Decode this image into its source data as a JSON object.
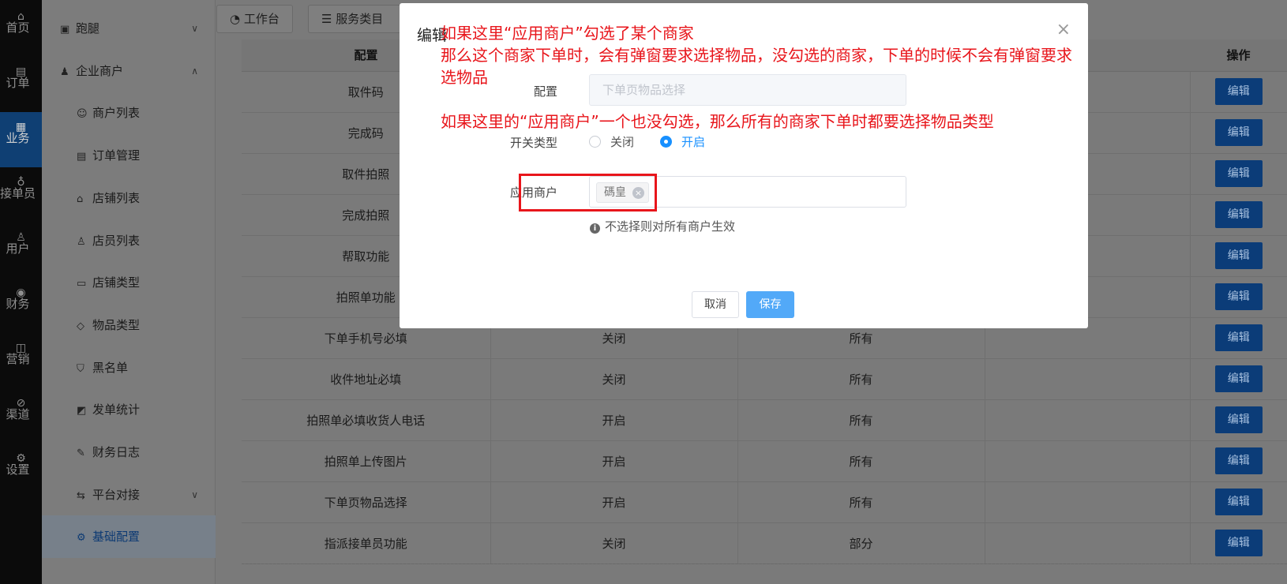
{
  "rail": [
    {
      "label": "首页",
      "icon": "home-icon",
      "glyph": "⌂"
    },
    {
      "label": "订单",
      "icon": "order-icon",
      "glyph": "▤"
    },
    {
      "label": "业务",
      "icon": "business-icon",
      "glyph": "▦",
      "active": true
    },
    {
      "label": "接单员",
      "icon": "bike-icon",
      "glyph": "♁"
    },
    {
      "label": "用户",
      "icon": "user-icon",
      "glyph": "♙"
    },
    {
      "label": "财务",
      "icon": "finance-icon",
      "glyph": "◉"
    },
    {
      "label": "营销",
      "icon": "chart-icon",
      "glyph": "◫"
    },
    {
      "label": "渠道",
      "icon": "channel-icon",
      "glyph": "⊘"
    },
    {
      "label": "设置",
      "icon": "settings-icon",
      "glyph": "⚙"
    }
  ],
  "sidebar": {
    "items": [
      {
        "label": "跑腿",
        "icon": "errand-icon",
        "glyph": "▣",
        "chevron": "∨",
        "type": "parent"
      },
      {
        "label": "企业商户",
        "icon": "merchant-group-icon",
        "glyph": "♟",
        "chevron": "∧",
        "type": "parent"
      },
      {
        "label": "商户列表",
        "icon": "merchant-list-icon",
        "glyph": "☺",
        "type": "child"
      },
      {
        "label": "订单管理",
        "icon": "order-manage-icon",
        "glyph": "▤",
        "type": "child"
      },
      {
        "label": "店铺列表",
        "icon": "shop-icon",
        "glyph": "⌂",
        "type": "child"
      },
      {
        "label": "店员列表",
        "icon": "clerk-icon",
        "glyph": "♙",
        "type": "child"
      },
      {
        "label": "店铺类型",
        "icon": "shop-type-icon",
        "glyph": "▭",
        "type": "child"
      },
      {
        "label": "物品类型",
        "icon": "tag-icon",
        "glyph": "◇",
        "type": "child"
      },
      {
        "label": "黑名单",
        "icon": "shield-icon",
        "glyph": "⛉",
        "type": "child"
      },
      {
        "label": "发单统计",
        "icon": "stats-icon",
        "glyph": "◩",
        "type": "child"
      },
      {
        "label": "财务日志",
        "icon": "log-icon",
        "glyph": "✎",
        "type": "child"
      },
      {
        "label": "平台对接",
        "icon": "swap-icon",
        "glyph": "⇆",
        "chevron": "∨",
        "type": "child"
      },
      {
        "label": "基础配置",
        "icon": "gear-icon",
        "glyph": "⚙",
        "type": "child",
        "active": true
      }
    ]
  },
  "topbar": {
    "workbench": "工作台",
    "service_category": "服务类目",
    "close_mark": "×"
  },
  "table": {
    "headers": {
      "config": "配置",
      "operation": "操作"
    },
    "rows": [
      {
        "config": "取件码",
        "switch": "",
        "scope": ""
      },
      {
        "config": "完成码",
        "switch": "",
        "scope": ""
      },
      {
        "config": "取件拍照",
        "switch": "",
        "scope": ""
      },
      {
        "config": "完成拍照",
        "switch": "",
        "scope": ""
      },
      {
        "config": "帮取功能",
        "switch": "",
        "scope": ""
      },
      {
        "config": "拍照单功能",
        "switch": "",
        "scope": ""
      },
      {
        "config": "下单手机号必填",
        "switch": "关闭",
        "scope": "所有"
      },
      {
        "config": "收件地址必填",
        "switch": "关闭",
        "scope": "所有"
      },
      {
        "config": "拍照单必填收货人电话",
        "switch": "开启",
        "scope": "所有"
      },
      {
        "config": "拍照单上传图片",
        "switch": "开启",
        "scope": "所有"
      },
      {
        "config": "下单页物品选择",
        "switch": "开启",
        "scope": "所有"
      },
      {
        "config": "指派接单员功能",
        "switch": "关闭",
        "scope": "部分"
      }
    ],
    "edit_label": "编辑"
  },
  "dialog": {
    "title": "编辑",
    "close": "×",
    "config_label": "配置",
    "config_placeholder": "下单页物品选择",
    "switch_label": "开关类型",
    "option_off": "关闭",
    "option_on": "开启",
    "selected_option": "开启",
    "merchant_label": "应用商户",
    "merchant_tag": "碼皇",
    "tag_remove": "×",
    "hint_icon": "i",
    "hint": "不选择则对所有商户生效",
    "cancel": "取消",
    "save": "保存"
  },
  "annotations": {
    "line1": "如果这里“应用商户”勾选了某个商家",
    "line2": "那么这个商家下单时，会有弹窗要求选择物品，没勾选的商家，下单的时候不会有弹窗要求",
    "line3": "选物品",
    "line4": "如果这里的“应用商户”一个也没勾选，那么所有的商家下单时都要选择物品类型"
  },
  "colors": {
    "annotation_red": "#e8151b",
    "primary_blue": "#1890ff",
    "save_blue": "#52a9f8"
  }
}
